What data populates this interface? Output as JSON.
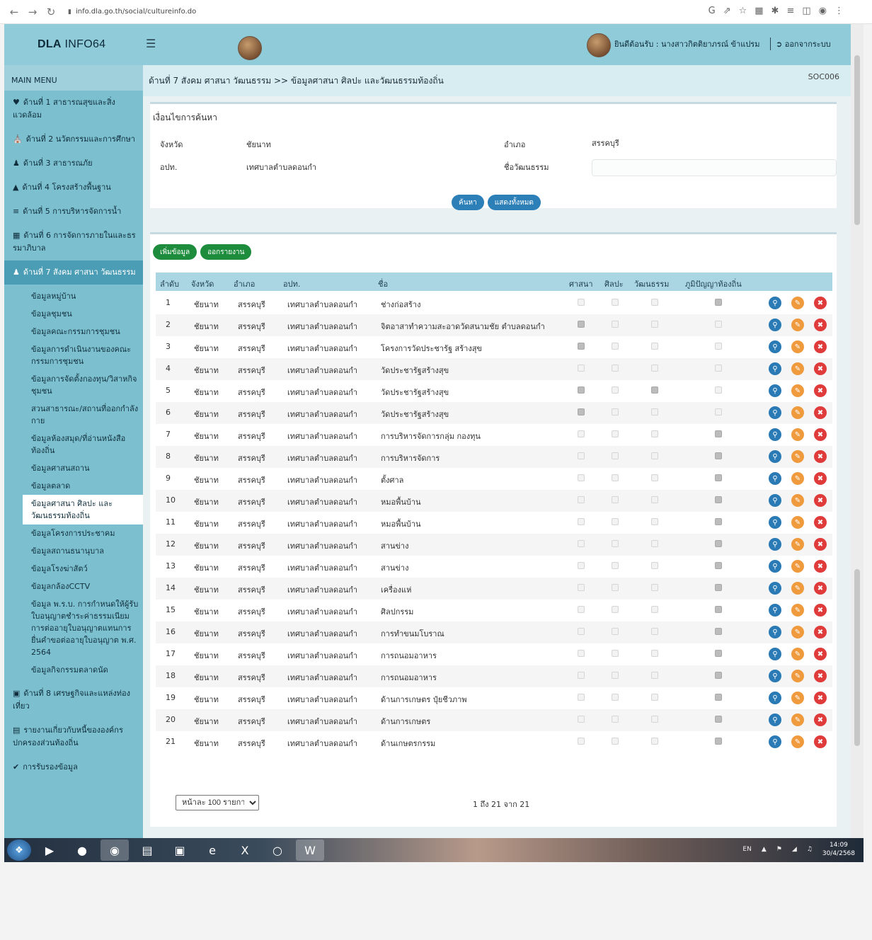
{
  "browser": {
    "url": "info.dla.go.th/social/cultureinfo.do"
  },
  "header": {
    "brand_bold": "DLA",
    "brand_rest": " INFO64",
    "welcome_text": "ยินดีต้อนรับ : นางสาวกิตติยาภรณ์ ข้าแปรม",
    "logout_label": "ออกจากระบบ"
  },
  "sidebar": {
    "title": "MAIN MENU",
    "items": [
      {
        "icon": "heart-icon",
        "label": "ด้านที่ 1 สาธารณสุขและสิ่งแวดล้อม"
      },
      {
        "icon": "education-icon",
        "label": "ด้านที่ 2 นวัตกรรมและการศึกษา"
      },
      {
        "icon": "people-icon",
        "label": "ด้านที่ 3 สาธารณภัย"
      },
      {
        "icon": "road-icon",
        "label": "ด้านที่ 4 โครงสร้างพื้นฐาน"
      },
      {
        "icon": "water-icon",
        "label": "ด้านที่ 5 การบริหารจัดการน้ำ"
      },
      {
        "icon": "building-icon",
        "label": "ด้านที่ 6 การจัดการภายในและธรรมาภิบาล"
      },
      {
        "icon": "group-icon",
        "label": "ด้านที่ 7 สังคม ศาสนา วัฒนธรรม"
      }
    ],
    "subitems": [
      "ข้อมูลหมู่บ้าน",
      "ข้อมูลชุมชน",
      "ข้อมูลคณะกรรมการชุมชน",
      "ข้อมูลการดำเนินงานของคณะกรรมการชุมชน",
      "ข้อมูลการจัดตั้งกองทุน/วิสาหกิจชุมชน",
      "สวนสาธารณะ/สถานที่ออกกำลังกาย",
      "ข้อมูลห้องสมุด/ที่อ่านหนังสือท้องถิ่น",
      "ข้อมูลศาสนสถาน",
      "ข้อมูลตลาด",
      "ข้อมูลศาสนา ศิลปะ และวัฒนธรรมท้องถิ่น",
      "ข้อมูลโครงการประชาคม",
      "ข้อมูลสถานธนานุบาล",
      "ข้อมูลโรงฆ่าสัตว์",
      "ข้อมูลกล้องCCTV",
      "ข้อมูล พ.ร.บ. การกำหนดให้ผู้รับใบอนุญาตชำระค่าธรรมเนียมการต่ออายุใบอนุญาตแทนการยื่นคำขอต่ออายุใบอนุญาต พ.ศ. 2564",
      "ข้อมูลกิจกรรมตลาดนัด"
    ],
    "lower_items": [
      {
        "icon": "camera-icon",
        "label": "ด้านที่ 8 เศรษฐกิจและแหล่งท่องเที่ยว"
      },
      {
        "icon": "report-icon",
        "label": "รายงานเกี่ยวกับหนี้ขององค์กรปกครองส่วนท้องถิ่น"
      },
      {
        "icon": "check-icon",
        "label": "การรับรองข้อมูล"
      }
    ]
  },
  "breadcrumb": {
    "text": "ด้านที่ 7 สังคม ศาสนา วัฒนธรรม >> ข้อมูลศาสนา ศิลปะ และวัฒนธรรมท้องถิ่น",
    "code": "SOC006"
  },
  "search": {
    "title": "เงื่อนไขการค้นหา",
    "province_label": "จังหวัด",
    "province_value": "ชัยนาท",
    "district_label": "อำเภอ",
    "district_value": "สรรคบุรี",
    "org_label": "อปท.",
    "org_value": "เทศบาลตำบลดอนกำ",
    "culture_name_label": "ชื่อวัฒนธรรม",
    "culture_name_value": "",
    "search_button": "ค้นหา",
    "show_all_button": "แสดงทั้งหมด"
  },
  "table": {
    "add_button": "เพิ่มข้อมูล",
    "report_button": "ออกรายงาน",
    "headers": [
      "ลำดับ",
      "จังหวัด",
      "อำเภอ",
      "อปท.",
      "ชื่อ",
      "ศาสนา",
      "ศิลปะ",
      "วัฒนธรรม",
      "ภูมิปัญญาท้องถิ่น"
    ],
    "rows": [
      {
        "no": "1",
        "province": "ชัยนาท",
        "district": "สรรคบุรี",
        "org": "เทศบาลตำบลดอนกำ",
        "name": "ช่างก่อสร้าง",
        "religion": false,
        "art": false,
        "culture": false,
        "wisdom": true
      },
      {
        "no": "2",
        "province": "ชัยนาท",
        "district": "สรรคบุรี",
        "org": "เทศบาลตำบลดอนกำ",
        "name": "จิตอาสาทำความสะอาดวัดสนามชัย ตำบลดอนกำ",
        "religion": true,
        "art": false,
        "culture": false,
        "wisdom": false
      },
      {
        "no": "3",
        "province": "ชัยนาท",
        "district": "สรรคบุรี",
        "org": "เทศบาลตำบลดอนกำ",
        "name": "โครงการวัดประชารัฐ สร้างสุข",
        "religion": true,
        "art": false,
        "culture": false,
        "wisdom": false
      },
      {
        "no": "4",
        "province": "ชัยนาท",
        "district": "สรรคบุรี",
        "org": "เทศบาลตำบลดอนกำ",
        "name": "วัดประชารัฐสร้างสุข",
        "religion": false,
        "art": false,
        "culture": false,
        "wisdom": false
      },
      {
        "no": "5",
        "province": "ชัยนาท",
        "district": "สรรคบุรี",
        "org": "เทศบาลตำบลดอนกำ",
        "name": "วัดประชารัฐสร้างสุข",
        "religion": true,
        "art": false,
        "culture": true,
        "wisdom": false
      },
      {
        "no": "6",
        "province": "ชัยนาท",
        "district": "สรรคบุรี",
        "org": "เทศบาลตำบลดอนกำ",
        "name": "วัดประชารัฐสร้างสุข",
        "religion": true,
        "art": false,
        "culture": false,
        "wisdom": false
      },
      {
        "no": "7",
        "province": "ชัยนาท",
        "district": "สรรคบุรี",
        "org": "เทศบาลตำบลดอนกำ",
        "name": "การบริหารจัดการกลุ่ม กองทุน",
        "religion": false,
        "art": false,
        "culture": false,
        "wisdom": true
      },
      {
        "no": "8",
        "province": "ชัยนาท",
        "district": "สรรคบุรี",
        "org": "เทศบาลตำบลดอนกำ",
        "name": "การบริหารจัดการ",
        "religion": false,
        "art": false,
        "culture": false,
        "wisdom": true
      },
      {
        "no": "9",
        "province": "ชัยนาท",
        "district": "สรรคบุรี",
        "org": "เทศบาลตำบลดอนกำ",
        "name": "ตั้งศาล",
        "religion": false,
        "art": false,
        "culture": false,
        "wisdom": true
      },
      {
        "no": "10",
        "province": "ชัยนาท",
        "district": "สรรคบุรี",
        "org": "เทศบาลตำบลดอนกำ",
        "name": "หมอพื้นบ้าน",
        "religion": false,
        "art": false,
        "culture": false,
        "wisdom": true
      },
      {
        "no": "11",
        "province": "ชัยนาท",
        "district": "สรรคบุรี",
        "org": "เทศบาลตำบลดอนกำ",
        "name": "หมอพื้นบ้าน",
        "religion": false,
        "art": false,
        "culture": false,
        "wisdom": true
      },
      {
        "no": "12",
        "province": "ชัยนาท",
        "district": "สรรคบุรี",
        "org": "เทศบาลตำบลดอนกำ",
        "name": "สานข่าง",
        "religion": false,
        "art": false,
        "culture": false,
        "wisdom": true
      },
      {
        "no": "13",
        "province": "ชัยนาท",
        "district": "สรรคบุรี",
        "org": "เทศบาลตำบลดอนกำ",
        "name": "สานข่าง",
        "religion": false,
        "art": false,
        "culture": false,
        "wisdom": true
      },
      {
        "no": "14",
        "province": "ชัยนาท",
        "district": "สรรคบุรี",
        "org": "เทศบาลตำบลดอนกำ",
        "name": "เครื่องแห่",
        "religion": false,
        "art": false,
        "culture": false,
        "wisdom": true
      },
      {
        "no": "15",
        "province": "ชัยนาท",
        "district": "สรรคบุรี",
        "org": "เทศบาลตำบลดอนกำ",
        "name": "ศิลปกรรม",
        "religion": false,
        "art": false,
        "culture": false,
        "wisdom": true
      },
      {
        "no": "16",
        "province": "ชัยนาท",
        "district": "สรรคบุรี",
        "org": "เทศบาลตำบลดอนกำ",
        "name": "การทำขนมโบราณ",
        "religion": false,
        "art": false,
        "culture": false,
        "wisdom": true
      },
      {
        "no": "17",
        "province": "ชัยนาท",
        "district": "สรรคบุรี",
        "org": "เทศบาลตำบลดอนกำ",
        "name": "การถนอมอาหาร",
        "religion": false,
        "art": false,
        "culture": false,
        "wisdom": true
      },
      {
        "no": "18",
        "province": "ชัยนาท",
        "district": "สรรคบุรี",
        "org": "เทศบาลตำบลดอนกำ",
        "name": "การถนอมอาหาร",
        "religion": false,
        "art": false,
        "culture": false,
        "wisdom": true
      },
      {
        "no": "19",
        "province": "ชัยนาท",
        "district": "สรรคบุรี",
        "org": "เทศบาลตำบลดอนกำ",
        "name": "ด้านการเกษตร ปุ๋ยชีวภาพ",
        "religion": false,
        "art": false,
        "culture": false,
        "wisdom": true
      },
      {
        "no": "20",
        "province": "ชัยนาท",
        "district": "สรรคบุรี",
        "org": "เทศบาลตำบลดอนกำ",
        "name": "ด้านการเกษตร",
        "religion": false,
        "art": false,
        "culture": false,
        "wisdom": true
      },
      {
        "no": "21",
        "province": "ชัยนาท",
        "district": "สรรคบุรี",
        "org": "เทศบาลตำบลดอนกำ",
        "name": "ด้านเกษตรกรรม",
        "religion": false,
        "art": false,
        "culture": false,
        "wisdom": true
      }
    ],
    "page_size": "หน้าละ 100 รายการ",
    "page_info": "1 ถึง 21 จาก 21"
  },
  "taskbar": {
    "language": "EN",
    "time": "14:09",
    "date": "30/4/2568"
  }
}
